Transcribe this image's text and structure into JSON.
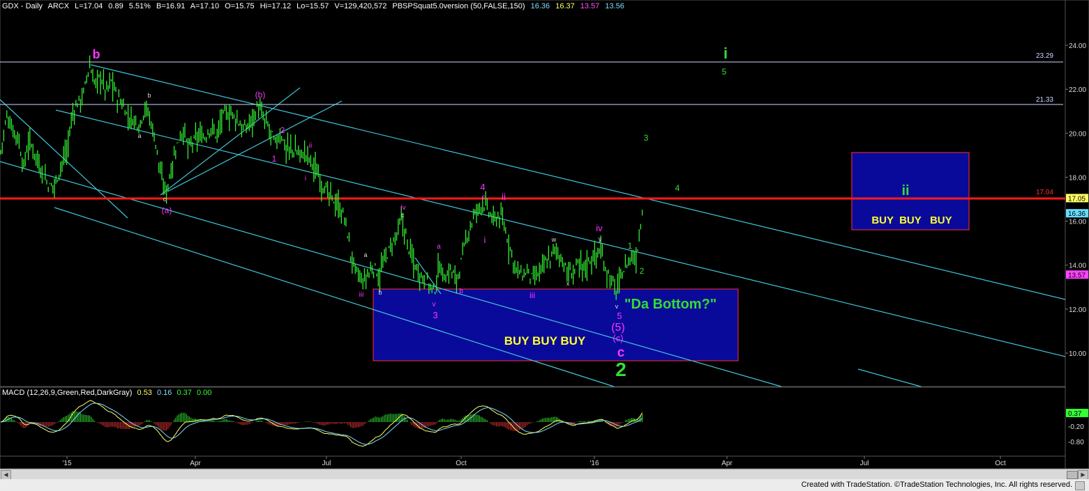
{
  "header": {
    "symbol": "GDX - Daily",
    "exchange": "ARCX",
    "last": "L=17.04",
    "change": "0.89",
    "change_pct": "5.51%",
    "bid": "B=16.91",
    "ask": "A=17.10",
    "open": "O=15.75",
    "high": "Hi=17.12",
    "low": "Lo=15.57",
    "volume": "V=129,420,572",
    "study": "PBSPSquat5.0version (50,FALSE,150)",
    "study_vals": [
      "16.36",
      "16.37",
      "13.57",
      "13.56"
    ],
    "study_colors": [
      "#7fdcff",
      "#ffff66",
      "#ff55ff",
      "#7fdcff"
    ]
  },
  "macd_header": {
    "label": "MACD (12,26,9,Green,Red,DarkGray)",
    "values": [
      "0.53",
      "0.16",
      "0.37",
      "0.00"
    ],
    "colors": [
      "#ffff66",
      "#7fdcff",
      "#33ff33",
      "#33ff33"
    ]
  },
  "footer": {
    "text": "Created with TradeStation. ©TradeStation Technologies, Inc. All rights reserved."
  },
  "chart_data": {
    "type": "candlestick",
    "x_ticks": [
      "'15",
      "Apr",
      "Jul",
      "Oct",
      "'16",
      "Apr",
      "Jul",
      "Oct"
    ],
    "y_ticks": [
      "24.00",
      "22.00",
      "20.00",
      "18.00",
      "16.00",
      "14.00",
      "12.00",
      "10.00"
    ],
    "ylim": [
      8.5,
      25.5
    ],
    "macd_ticks": [
      "0.37",
      "-0.20",
      "-0.80"
    ],
    "price_path": [
      [
        0,
        19.0
      ],
      [
        10,
        20.8
      ],
      [
        18,
        20.2
      ],
      [
        26,
        19.8
      ],
      [
        34,
        18.4
      ],
      [
        40,
        19.6
      ],
      [
        48,
        19.3
      ],
      [
        56,
        18.6
      ],
      [
        64,
        18.0
      ],
      [
        72,
        17.5
      ],
      [
        80,
        17.8
      ],
      [
        88,
        18.6
      ],
      [
        96,
        19.2
      ],
      [
        104,
        20.9
      ],
      [
        112,
        21.4
      ],
      [
        120,
        21.8
      ],
      [
        128,
        23.1
      ],
      [
        136,
        22.2
      ],
      [
        144,
        22.6
      ],
      [
        152,
        21.9
      ],
      [
        160,
        22.4
      ],
      [
        168,
        21.6
      ],
      [
        176,
        21.3
      ],
      [
        184,
        20.7
      ],
      [
        192,
        20.6
      ],
      [
        200,
        20.4
      ],
      [
        208,
        21.2
      ],
      [
        216,
        20.6
      ],
      [
        224,
        19.4
      ],
      [
        232,
        17.8
      ],
      [
        238,
        17.3
      ],
      [
        246,
        18.5
      ],
      [
        254,
        19.5
      ],
      [
        262,
        20.2
      ],
      [
        270,
        19.3
      ],
      [
        278,
        19.6
      ],
      [
        286,
        19.9
      ],
      [
        294,
        19.8
      ],
      [
        302,
        20.3
      ],
      [
        310,
        19.9
      ],
      [
        320,
        20.8
      ],
      [
        330,
        20.9
      ],
      [
        340,
        20.6
      ],
      [
        350,
        20.1
      ],
      [
        360,
        20.6
      ],
      [
        370,
        21.2
      ],
      [
        378,
        20.6
      ],
      [
        386,
        20.2
      ],
      [
        394,
        19.5
      ],
      [
        402,
        20.0
      ],
      [
        410,
        19.3
      ],
      [
        420,
        19.2
      ],
      [
        430,
        19.1
      ],
      [
        440,
        19.0
      ],
      [
        448,
        18.6
      ],
      [
        456,
        18.1
      ],
      [
        464,
        17.6
      ],
      [
        472,
        17.1
      ],
      [
        480,
        16.9
      ],
      [
        488,
        16.5
      ],
      [
        496,
        15.9
      ],
      [
        504,
        14.2
      ],
      [
        512,
        13.6
      ],
      [
        520,
        13.2
      ],
      [
        528,
        13.6
      ],
      [
        536,
        13.9
      ],
      [
        544,
        13.5
      ],
      [
        552,
        14.3
      ],
      [
        560,
        14.8
      ],
      [
        568,
        15.3
      ],
      [
        576,
        16.1
      ],
      [
        584,
        15.0
      ],
      [
        592,
        14.2
      ],
      [
        600,
        13.7
      ],
      [
        608,
        13.4
      ],
      [
        616,
        13.1
      ],
      [
        622,
        12.7
      ],
      [
        630,
        14.0
      ],
      [
        638,
        13.4
      ],
      [
        646,
        13.8
      ],
      [
        654,
        13.3
      ],
      [
        662,
        14.2
      ],
      [
        670,
        15.4
      ],
      [
        678,
        16.1
      ],
      [
        686,
        16.6
      ],
      [
        692,
        16.9
      ],
      [
        700,
        16.4
      ],
      [
        708,
        16.0
      ],
      [
        716,
        16.3
      ],
      [
        724,
        15.6
      ],
      [
        732,
        14.7
      ],
      [
        740,
        13.8
      ],
      [
        748,
        13.5
      ],
      [
        756,
        13.7
      ],
      [
        764,
        13.3
      ],
      [
        772,
        13.6
      ],
      [
        780,
        14.0
      ],
      [
        788,
        14.3
      ],
      [
        796,
        14.7
      ],
      [
        804,
        14.4
      ],
      [
        812,
        13.7
      ],
      [
        820,
        13.6
      ],
      [
        828,
        14.0
      ],
      [
        836,
        13.9
      ],
      [
        844,
        14.2
      ],
      [
        852,
        14.4
      ],
      [
        860,
        14.7
      ],
      [
        868,
        13.9
      ],
      [
        876,
        13.3
      ],
      [
        884,
        12.8
      ],
      [
        890,
        13.5
      ],
      [
        898,
        14.0
      ],
      [
        906,
        14.4
      ],
      [
        912,
        14.3
      ],
      [
        918,
        15.8
      ],
      [
        922,
        17.0
      ]
    ],
    "price_labels": [
      "23.29",
      "21.33",
      "17.04"
    ],
    "price_levels": [
      23.29,
      21.33,
      17.04
    ],
    "side_badges": [
      {
        "text": "17.05",
        "value": 17.05,
        "bg": "#ffff66",
        "fg": "#000"
      },
      {
        "text": "16.36",
        "value": 16.36,
        "bg": "#66ddff",
        "fg": "#000"
      },
      {
        "text": "13.57",
        "value": 13.57,
        "bg": "#ff44ff",
        "fg": "#000"
      }
    ],
    "annotations": {
      "b_top": "b",
      "b_small": "b",
      "a_small": "a",
      "c_small": "c",
      "a_paren": "(a)",
      "b_paren": "(b)",
      "one_small": "1",
      "two_small": "2",
      "i_small": "i",
      "ii_small": "ii",
      "iii_low": "iii",
      "a2": "a",
      "b2": "b",
      "c2": "c",
      "iv": "iv",
      "v_low": "v",
      "three": "3",
      "a3": "a",
      "b3": "b",
      "four": "4",
      "c3": "c",
      "ii_big": "ii",
      "i_mid": "i",
      "iii_mid": "iii",
      "w": "w",
      "x": "x",
      "y": "y",
      "iv2": "iv",
      "v2": "v",
      "five": "5",
      "five_paren": "(5)",
      "c_paren": "(c)",
      "c_big": "c",
      "two_big": "2",
      "one_green": "1",
      "two_green": "2",
      "three_green": "3",
      "four_green": "4",
      "five_green": "5",
      "i_green": "i",
      "bottom_q": "\"Da Bottom?\"",
      "buy_left": "BUY BUY BUY",
      "buy_right": "BUY  BUY   BUY",
      "ii_green": "ii"
    }
  }
}
